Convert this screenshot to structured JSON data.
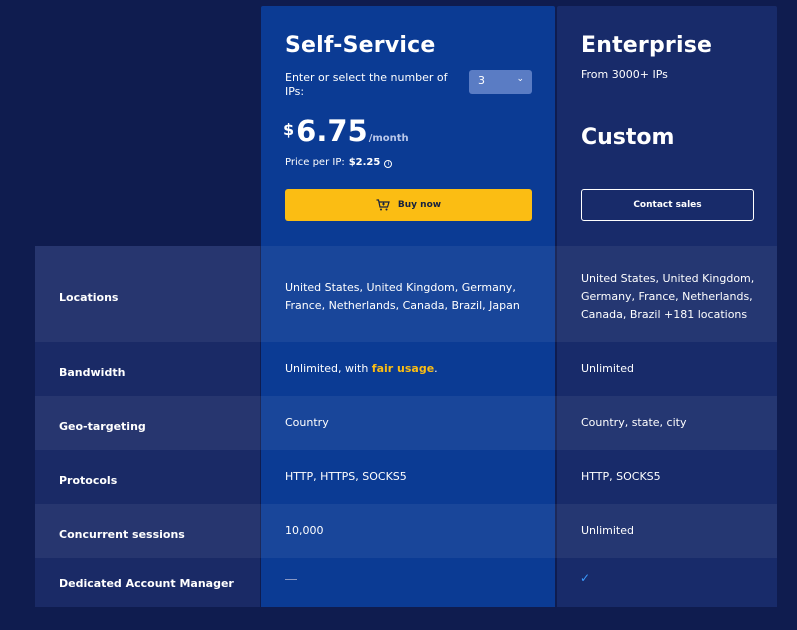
{
  "self_service": {
    "title": "Self-Service",
    "ip_prompt": "Enter or select the number of IPs:",
    "ip_count": "3",
    "currency": "$",
    "price": "6.75",
    "period": "/month",
    "price_per_ip_label": "Price per IP:",
    "price_per_ip": "$2.25",
    "buy_label": "Buy now"
  },
  "enterprise": {
    "title": "Enterprise",
    "subtitle": "From 3000+ IPs",
    "price": "Custom",
    "contact_label": "Contact sales"
  },
  "rows": [
    {
      "label": "Locations",
      "self": "United States, United Kingdom, Germany, France, Netherlands, Canada, Brazil, Japan",
      "ent": "United States, United Kingdom, Germany, France, Netherlands, Canada, Brazil +181 locations"
    },
    {
      "label": "Bandwidth",
      "self_prefix": "Unlimited, with ",
      "self_link": "fair usage",
      "self_suffix": ".",
      "ent": "Unlimited"
    },
    {
      "label": "Geo-targeting",
      "self": "Country",
      "ent": "Country, state, city"
    },
    {
      "label": "Protocols",
      "self": "HTTP, HTTPS, SOCKS5",
      "ent": "HTTP, SOCKS5"
    },
    {
      "label": "Concurrent sessions",
      "self": "10,000",
      "ent": "Unlimited"
    },
    {
      "label": "Dedicated Account Manager",
      "self": "",
      "ent": ""
    }
  ],
  "colors": {
    "background": "#0f1c4f",
    "self_column": "#0b3b94",
    "enterprise_column": "#182b6a",
    "accent": "#fbbd13",
    "check": "#3b9bff"
  },
  "icons": {
    "cart": "cart-icon",
    "info": "info-icon",
    "chevron": "chevron-down-icon",
    "check": "check-icon",
    "dash": "dash-icon"
  }
}
